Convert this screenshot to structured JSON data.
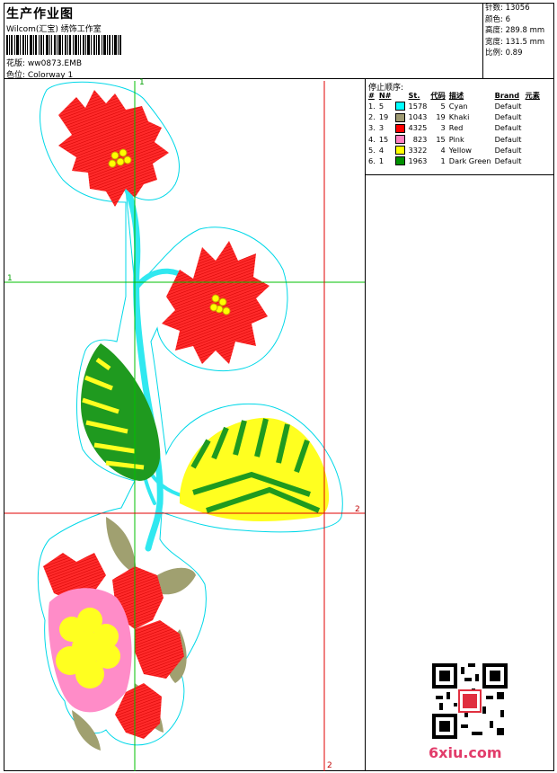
{
  "header": {
    "title": "生产作业图",
    "company": "Wilcom(汇宝) 绣饰工作室",
    "design_line": "花版:  ww0873.EMB",
    "colorway_line": "色位:  Colorway 1"
  },
  "stats": {
    "stitches": "针数: 13056",
    "colors": "颜色: 6",
    "height": "高度: 289.8 mm",
    "width": "宽度: 131.5 mm",
    "ratio": "比例: 0.89"
  },
  "sequence": {
    "title": "停止顺序:",
    "headers": [
      "#",
      "N#",
      "St.",
      "代码",
      "描述",
      "Brand",
      "元素"
    ],
    "rows": [
      {
        "idx": "1.",
        "n": "5",
        "color": "#00ffff",
        "st": "1578",
        "code": "5",
        "desc": "Cyan",
        "brand": "Default"
      },
      {
        "idx": "2.",
        "n": "19",
        "color": "#9e9a72",
        "st": "1043",
        "code": "19",
        "desc": "Khaki",
        "brand": "Default"
      },
      {
        "idx": "3.",
        "n": "3",
        "color": "#ff0000",
        "st": "4325",
        "code": "3",
        "desc": "Red",
        "brand": "Default"
      },
      {
        "idx": "4.",
        "n": "15",
        "color": "#ff80c0",
        "st": "823",
        "code": "15",
        "desc": "Pink",
        "brand": "Default"
      },
      {
        "idx": "5.",
        "n": "4",
        "color": "#ffff00",
        "st": "3322",
        "code": "4",
        "desc": "Yellow",
        "brand": "Default"
      },
      {
        "idx": "6.",
        "n": "1",
        "color": "#009000",
        "st": "1963",
        "code": "1",
        "desc": "Dark Green",
        "brand": "Default"
      }
    ]
  },
  "guides": {
    "v1_top": "1",
    "h1_left": "1",
    "h2_right": "2",
    "v2_bottom": "2"
  },
  "watermark": "6xiu.com",
  "colors": {
    "cyan": "#00e0e0",
    "red": "#ff1a1a",
    "green": "#1f9a1f",
    "yellow": "#ffff20",
    "khaki": "#a0a070",
    "pink": "#ff8cc8",
    "guide_green": "#00c000",
    "guide_red": "#e00000"
  }
}
